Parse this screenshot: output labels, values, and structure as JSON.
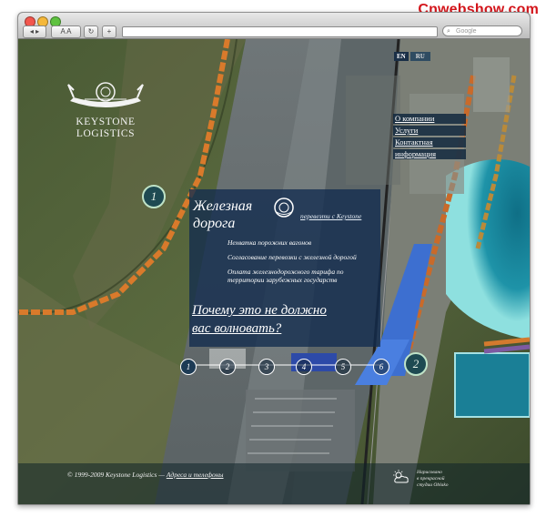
{
  "watermark": "Cnwebshow.com",
  "browser": {
    "search_placeholder": "Google",
    "reader_label": "A A"
  },
  "logo": {
    "line1": "KEYSTONE",
    "line2": "LOGISTICS"
  },
  "lang": {
    "en": "EN",
    "ru": "RU"
  },
  "nav": {
    "about": "О компании",
    "services": "Услуги",
    "contacts_1": "Контактная",
    "contacts_2": "информация"
  },
  "panel": {
    "title_1": "Железная",
    "title_2": "дорога",
    "translate": "перевезти с Keystone",
    "items": [
      "Нехватка порожних вагонов",
      "Согласование перевозки с железной дорогой",
      "Оплата железнодорожного тарифа по",
      "территории зарубежных государств"
    ],
    "question_1": "Почему это не должно",
    "question_2": "вас волновать?"
  },
  "steps": [
    "1",
    "2",
    "3",
    "4",
    "5",
    "6"
  ],
  "map_markers": {
    "left": "1",
    "right": "2"
  },
  "footer": {
    "copyright": "© 1999-2009 Keystone Logistics —",
    "link": "Адреса и телефоны",
    "studio_1": "Нарисовано",
    "studio_2": "в прекрасной",
    "studio_3": "студии Oblako"
  },
  "colors": {
    "panel": "#122c4e",
    "accent_red": "#d4151b",
    "water": "#1e93a8"
  }
}
